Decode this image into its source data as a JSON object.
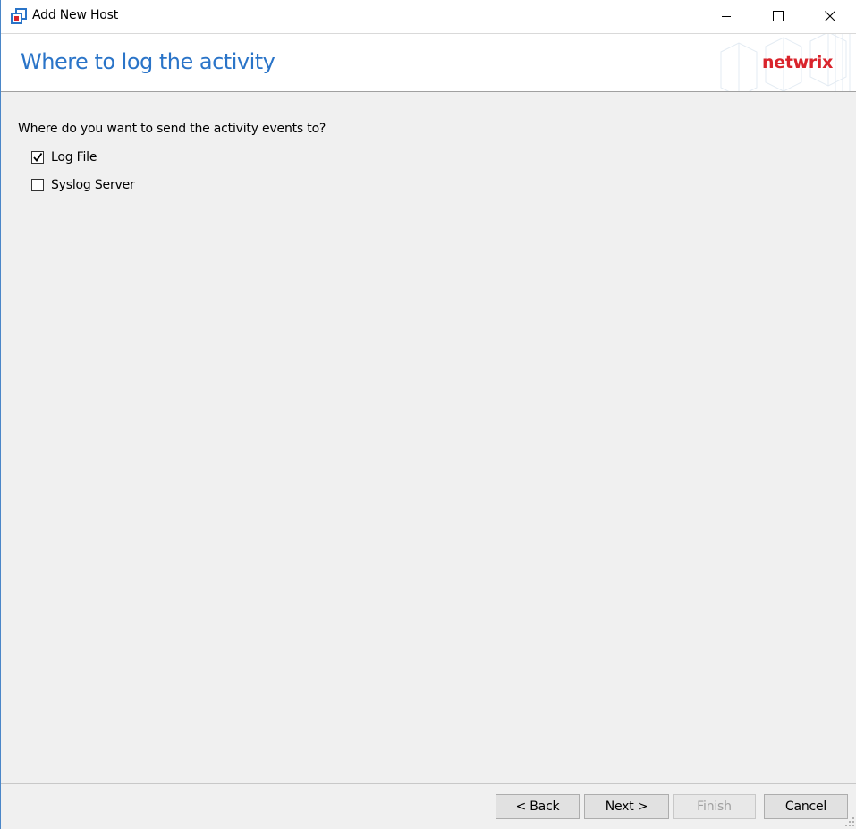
{
  "window": {
    "title": "Add New Host",
    "controls": {
      "minimize": "minimize-icon",
      "maximize": "maximize-icon",
      "close": "close-icon"
    }
  },
  "header": {
    "title": "Where to log the activity",
    "logo_text": "netwrix",
    "title_color": "#2a74c8",
    "logo_color": "#d9242c"
  },
  "content": {
    "question": "Where do you want to send the activity events to?",
    "options": [
      {
        "label": "Log File",
        "checked": true
      },
      {
        "label": "Syslog Server",
        "checked": false
      }
    ]
  },
  "footer": {
    "back_label": "< Back",
    "next_label": "Next >",
    "finish_label": "Finish",
    "finish_enabled": false,
    "cancel_label": "Cancel"
  }
}
